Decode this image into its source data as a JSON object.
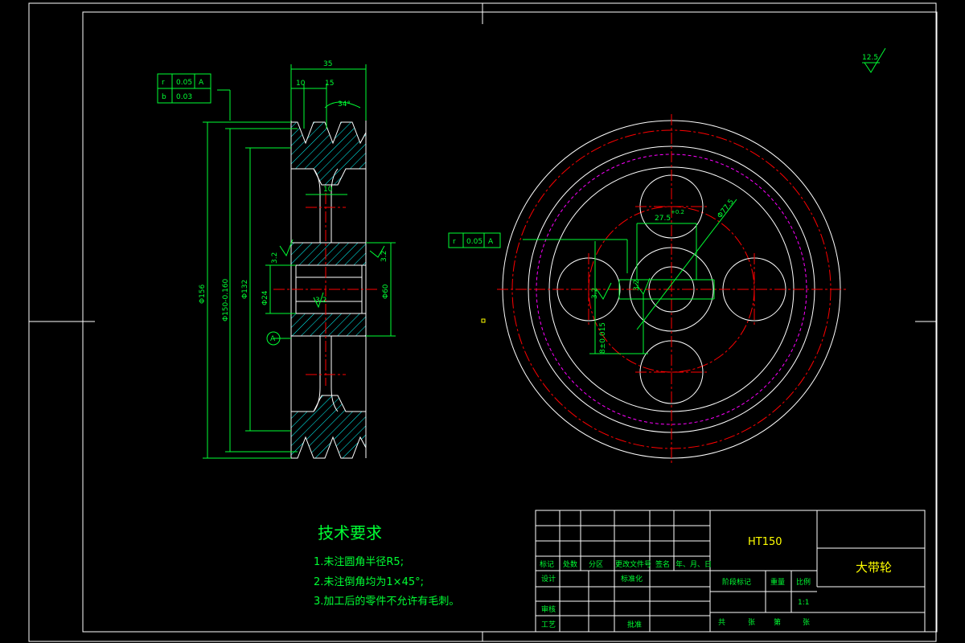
{
  "drawing": {
    "roughness_general": "12.5",
    "material": "HT150",
    "part_name": "大带轮",
    "scale": "1:1",
    "tech_req_title": "技术要求",
    "tech_req": [
      "1.未注圆角半径R5;",
      "2.未注倒角均为1×45°;",
      "3.加工后的零件不允许有毛刺。"
    ],
    "tolerance_side": {
      "row1_symbol": "r",
      "row1_value": "0.05",
      "row1_datum": "A",
      "row2_symbol": "b",
      "row2_value": "0.03"
    },
    "tolerance_front": {
      "symbol": "r",
      "value": "0.05",
      "datum": "A"
    },
    "datum_label": "A",
    "side_dims": {
      "width_total": "35",
      "groove_offset": "10",
      "groove_pitch": "15",
      "groove_angle": "34°",
      "hub_width": "10",
      "od": "Φ156",
      "pitch_d": "Φ150-0.160",
      "web_d": "Φ132",
      "bore": "Φ24",
      "hub_d": "Φ60",
      "rough_left": "3.2",
      "rough_right": "3.2",
      "rough_bore": "3.2"
    },
    "front_dims": {
      "keyway_depth": "27.5",
      "keyway_tol": "+0.2",
      "hole_pcd": "Φ77.5",
      "key_width": "8±0.015",
      "rough_key1": "3.2",
      "rough_key2": "3.2"
    },
    "title_block": {
      "header": [
        "标记",
        "处数",
        "分区",
        "更改文件号",
        "签名",
        "年、月、日"
      ],
      "design": "设计",
      "standard": "标准化",
      "stage_mark": "阶段标记",
      "weight": "重量",
      "scale_label": "比例",
      "review": "审核",
      "process": "工艺",
      "approve": "批准",
      "footer": [
        "共",
        "张",
        "第",
        "张"
      ]
    }
  }
}
